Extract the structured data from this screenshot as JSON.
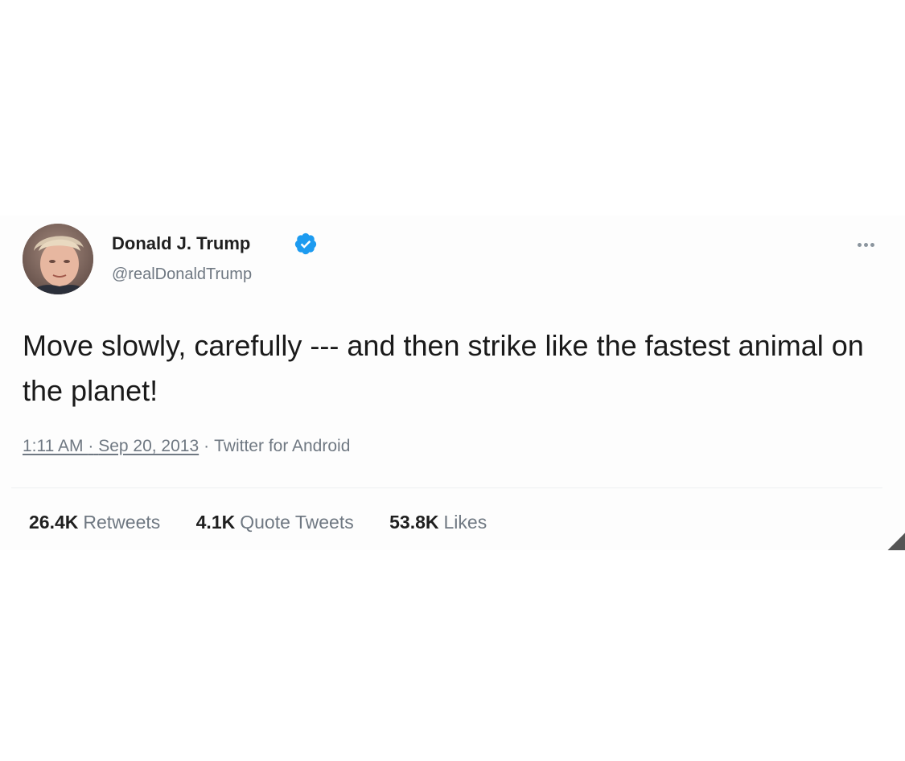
{
  "tweet": {
    "author": {
      "display_name": "Donald J. Trump",
      "handle": "@realDonaldTrump",
      "verified": true
    },
    "text": "Move slowly, carefully --- and then strike like the fastest animal on the planet!",
    "time": "1:11 AM",
    "date": "Sep 20, 2013",
    "separator": "·",
    "source": "Twitter for Android",
    "stats": {
      "retweets": {
        "count": "26.4K",
        "label": "Retweets"
      },
      "quote_tweets": {
        "count": "4.1K",
        "label": "Quote Tweets"
      },
      "likes": {
        "count": "53.8K",
        "label": "Likes"
      }
    },
    "icons": {
      "verified": "verified-badge-icon",
      "more": "more-options-icon"
    },
    "colors": {
      "verified_blue": "#1d9bf0",
      "secondary_text": "#6f7882",
      "primary_text": "#1a1a1a"
    }
  }
}
